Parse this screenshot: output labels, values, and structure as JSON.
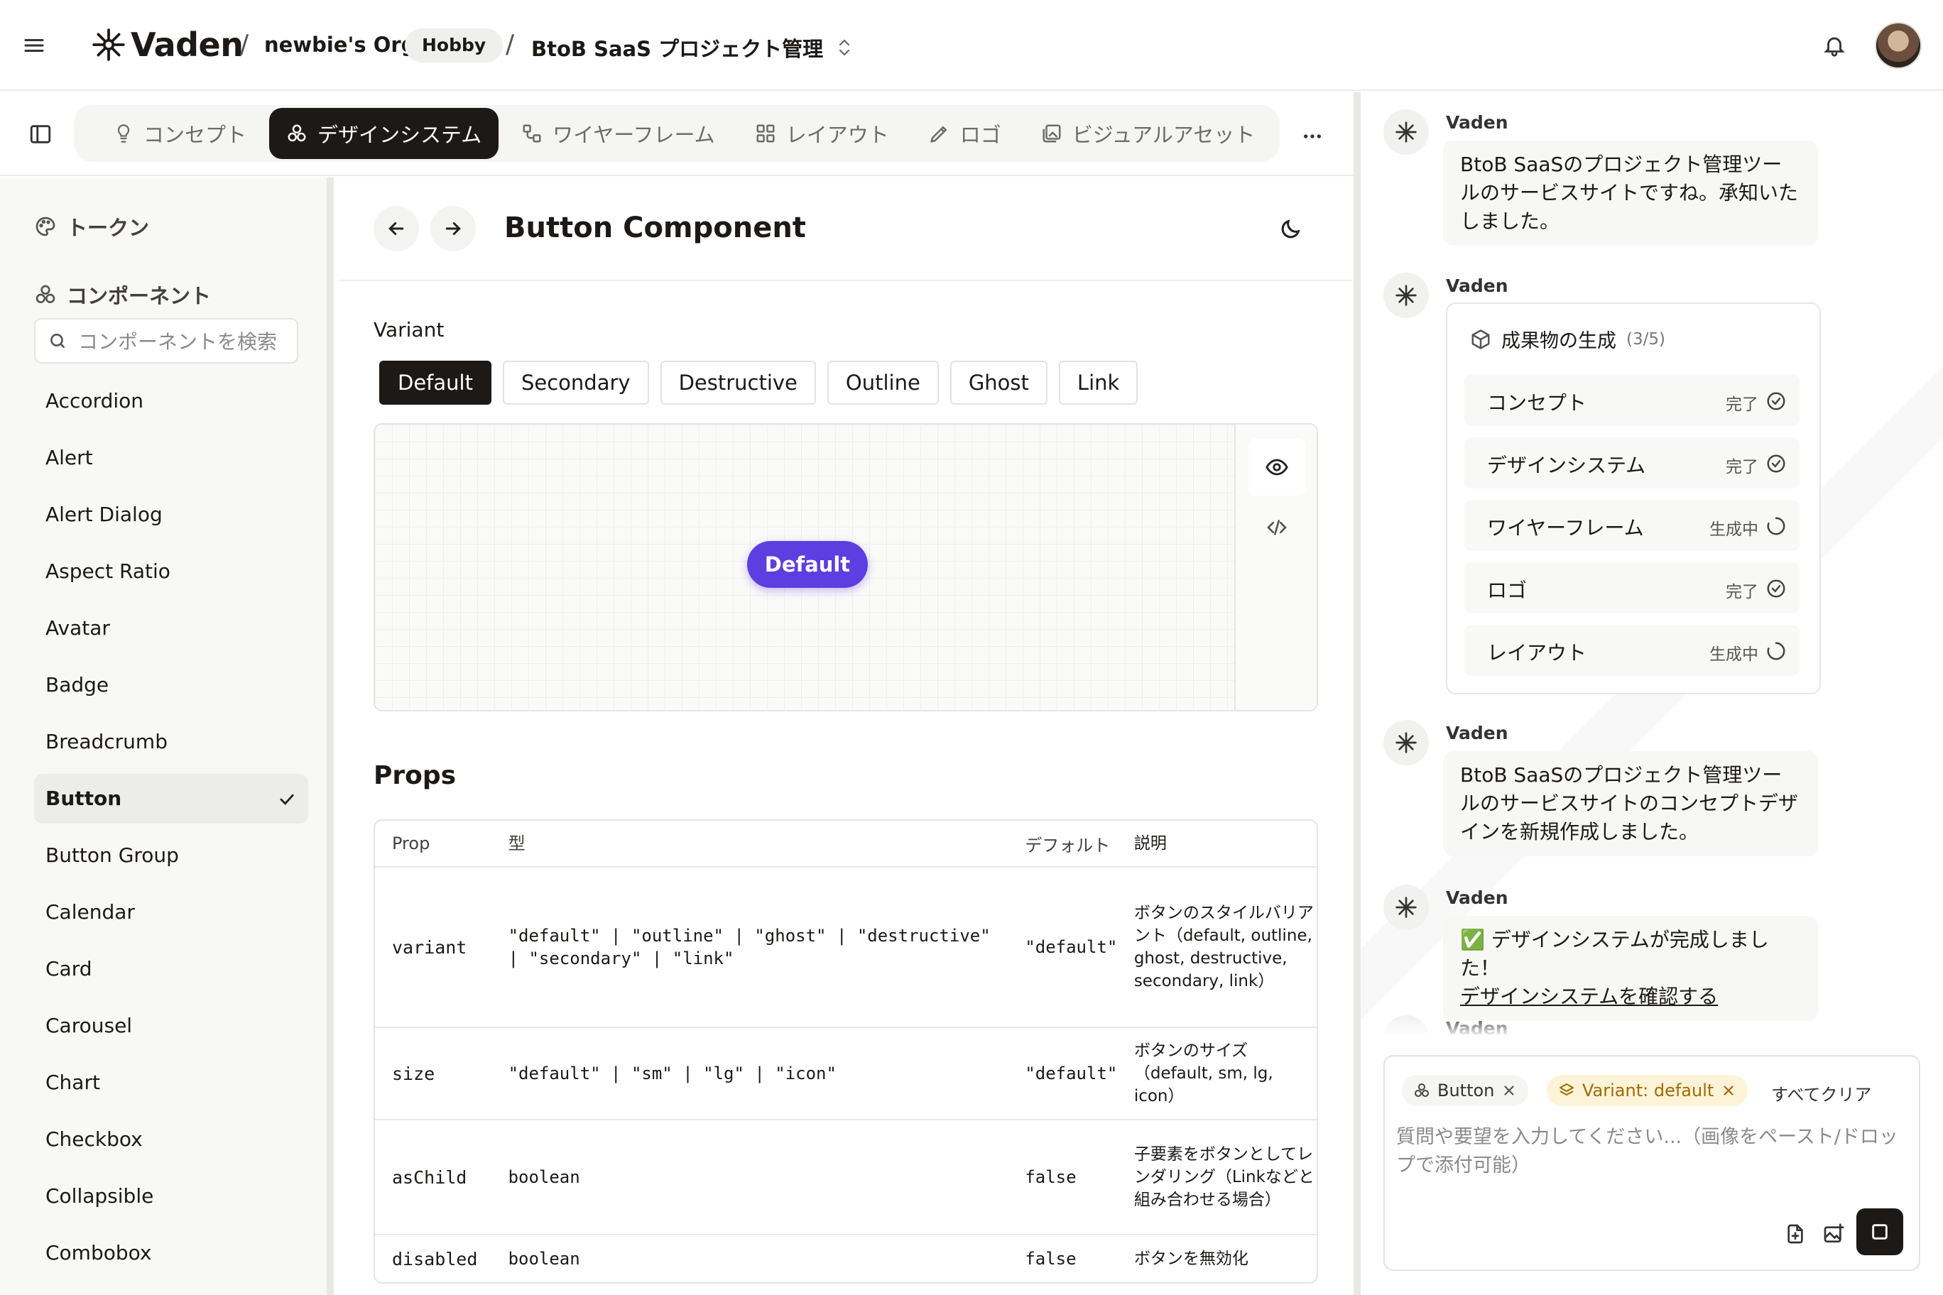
{
  "topbar": {
    "brand": "Vaden",
    "separator": "/",
    "org": "newbie's Org",
    "plan": "Hobby",
    "project": "BtoB SaaS プロジェクト管理"
  },
  "tabs": [
    {
      "label": "コンセプト",
      "icon": "lightbulb-icon"
    },
    {
      "label": "デザインシステム",
      "icon": "shapes-icon",
      "active": true
    },
    {
      "label": "ワイヤーフレーム",
      "icon": "workflow-icon"
    },
    {
      "label": "レイアウト",
      "icon": "grid-icon"
    },
    {
      "label": "ロゴ",
      "icon": "pen-tool-icon"
    },
    {
      "label": "ビジュアルアセット",
      "icon": "images-icon"
    }
  ],
  "sidebar": {
    "tokens_label": "トークン",
    "components_label": "コンポーネント",
    "search_placeholder": "コンポーネントを検索",
    "items": [
      "Accordion",
      "Alert",
      "Alert Dialog",
      "Aspect Ratio",
      "Avatar",
      "Badge",
      "Breadcrumb",
      "Button",
      "Button Group",
      "Calendar",
      "Card",
      "Carousel",
      "Chart",
      "Checkbox",
      "Collapsible",
      "Combobox"
    ],
    "selected": "Button"
  },
  "main": {
    "title": "Button Component",
    "variant_label": "Variant",
    "variants": [
      "Default",
      "Secondary",
      "Destructive",
      "Outline",
      "Ghost",
      "Link"
    ],
    "active_variant": "Default",
    "demo_button": "Default",
    "accent": "#5b3fe0",
    "props_title": "Props",
    "props_headers": [
      "Prop",
      "型",
      "デフォルト",
      "説明"
    ],
    "props_rows": [
      {
        "prop": "variant",
        "type": "\"default\" | \"outline\" | \"ghost\" | \"destructive\" | \"secondary\" | \"link\"",
        "default": "\"default\"",
        "desc": "ボタンのスタイルバリアント（default, outline, ghost, destructive, secondary, link）"
      },
      {
        "prop": "size",
        "type": "\"default\" | \"sm\" | \"lg\" | \"icon\"",
        "default": "\"default\"",
        "desc": "ボタンのサイズ（default, sm, lg, icon）"
      },
      {
        "prop": "asChild",
        "type": "boolean",
        "default": "false",
        "desc": "子要素をボタンとしてレンダリング（Linkなどと組み合わせる場合）"
      },
      {
        "prop": "disabled",
        "type": "boolean",
        "default": "false",
        "desc": "ボタンを無効化"
      }
    ]
  },
  "chat": {
    "bot_name": "Vaden",
    "msg1": "BtoB SaaSのプロジェクト管理ツールのサービスサイトですね。承知いたしました。",
    "gen_title": "成果物の生成",
    "gen_count": "(3/5)",
    "gen_items": [
      {
        "label": "コンセプト",
        "status": "完了",
        "done": true
      },
      {
        "label": "デザインシステム",
        "status": "完了",
        "done": true
      },
      {
        "label": "ワイヤーフレーム",
        "status": "生成中",
        "done": false
      },
      {
        "label": "ロゴ",
        "status": "完了",
        "done": true
      },
      {
        "label": "レイアウト",
        "status": "生成中",
        "done": false
      }
    ],
    "msg3": "BtoB SaaSのプロジェクト管理ツールのサービスサイトのコンセプトデザインを新規作成しました。",
    "msg4_text": "✅ デザインシステムが完成しました！",
    "msg4_link": "デザインシステムを確認する",
    "chip_component": "Button",
    "chip_variant": "Variant: default",
    "clear_all": "すべてクリア",
    "input_placeholder": "質問や要望を入力してください...（画像をペースト/ドロップで添付可能）"
  }
}
